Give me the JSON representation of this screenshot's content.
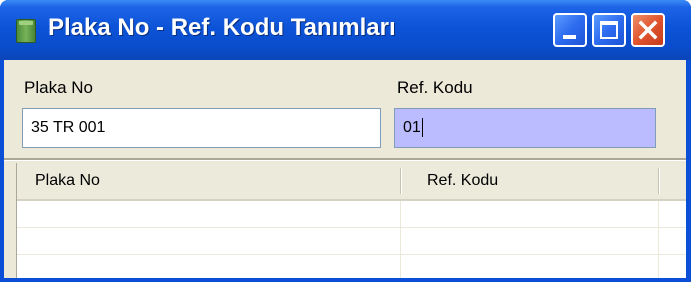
{
  "window": {
    "title": "Plaka No - Ref. Kodu Tanımları",
    "icon": "app-icon",
    "controls": [
      "minimize-icon",
      "maximize-icon",
      "close-icon"
    ],
    "colors": {
      "titlebar": "#0a4fd6",
      "client": "#ece9d8",
      "active_field": "#bbbbff",
      "close_button": "#e0552e"
    }
  },
  "form": {
    "plaka_label": "Plaka No",
    "plaka_value": "35 TR 001",
    "ref_label": "Ref. Kodu",
    "ref_value": "01"
  },
  "grid": {
    "columns": [
      "Plaka No",
      "Ref. Kodu",
      ""
    ],
    "rows": [
      [
        "",
        "",
        ""
      ],
      [
        "",
        "",
        ""
      ],
      [
        "",
        "",
        ""
      ]
    ]
  }
}
